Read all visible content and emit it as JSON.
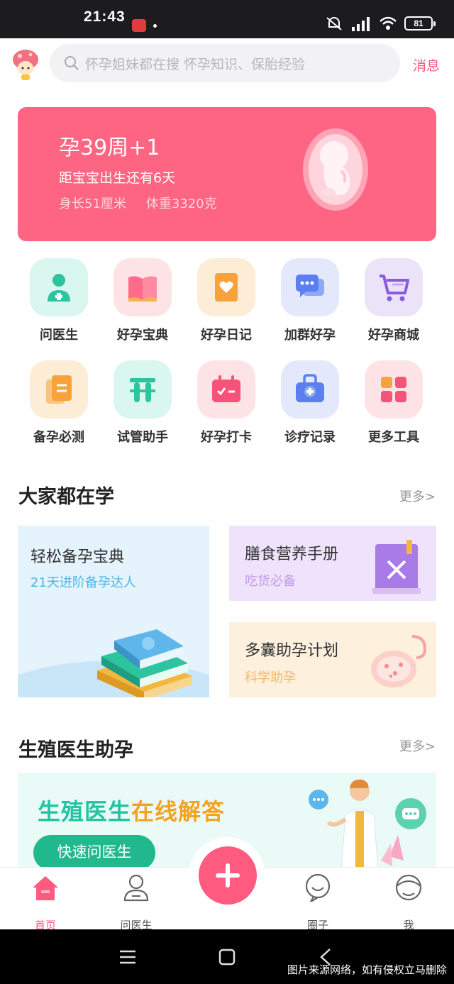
{
  "status_bar": {
    "time": "21:43",
    "battery": "81"
  },
  "header": {
    "search_placeholder": "怀孕姐妹都在搜 怀孕知识、保胎经验",
    "message_label": "消息"
  },
  "pregnancy_card": {
    "week": "孕39周+1",
    "countdown": "距宝宝出生还有6天",
    "length": "身长51厘米",
    "weight": "体重3320克"
  },
  "tools": [
    {
      "label": "问医生",
      "icon": "doctor-icon",
      "bg": "#d9f6ef"
    },
    {
      "label": "好孕宝典",
      "icon": "book-icon",
      "bg": "#fde3e6"
    },
    {
      "label": "好孕日记",
      "icon": "diary-icon",
      "bg": "#fdecd6"
    },
    {
      "label": "加群好孕",
      "icon": "chat-group-icon",
      "bg": "#e3e9fb"
    },
    {
      "label": "好孕商城",
      "icon": "cart-icon",
      "bg": "#ebe3f7"
    },
    {
      "label": "备孕必测",
      "icon": "checklist-icon",
      "bg": "#fdecd6"
    },
    {
      "label": "试管助手",
      "icon": "test-tube-icon",
      "bg": "#d9f6ef"
    },
    {
      "label": "好孕打卡",
      "icon": "calendar-icon",
      "bg": "#fde3e6"
    },
    {
      "label": "诊疗记录",
      "icon": "medical-kit-icon",
      "bg": "#e3e9fb"
    },
    {
      "label": "更多工具",
      "icon": "more-tools-icon",
      "bg": "#fde3e6"
    }
  ],
  "learning": {
    "title": "大家都在学",
    "more": "更多>",
    "cards": [
      {
        "title": "轻松备孕宝典",
        "subtitle": "21天进阶备孕达人"
      },
      {
        "title": "膳食营养手册",
        "subtitle": "吃货必备"
      },
      {
        "title": "多囊助孕计划",
        "subtitle": "科学助孕"
      }
    ]
  },
  "doctor": {
    "title": "生殖医生助孕",
    "more": "更多>",
    "banner_title_a": "生殖医生",
    "banner_title_b": "在线解答",
    "banner_button": "快速问医生"
  },
  "tabbar": {
    "home": "首页",
    "ask_doctor": "问医生",
    "circle": "圈子",
    "me": "我"
  },
  "watermark": "图片来源网络，如有侵权立马删除",
  "colors": {
    "accent": "#ff5a7f",
    "card": "#fe6582",
    "teal": "#21b88e"
  }
}
